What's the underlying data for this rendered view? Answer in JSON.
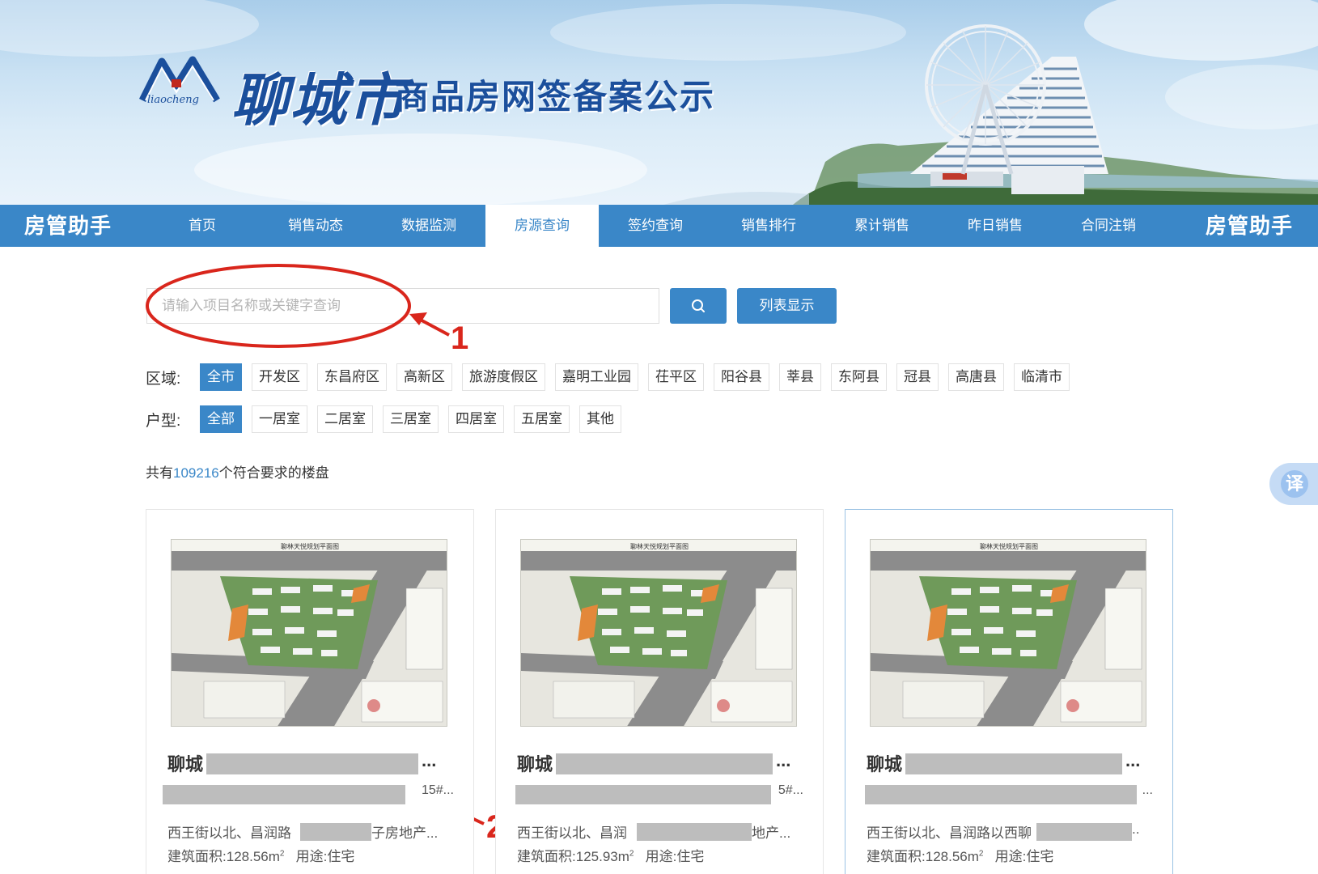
{
  "banner": {
    "logo_text": "聊城市",
    "subtitle": "商品房网签备案公示",
    "logo_pinyin": "liaocheng"
  },
  "nav": {
    "brand_left": "房管助手",
    "brand_right": "房管助手",
    "items": [
      {
        "label": "首页",
        "active": false
      },
      {
        "label": "销售动态",
        "active": false
      },
      {
        "label": "数据监测",
        "active": false
      },
      {
        "label": "房源查询",
        "active": true
      },
      {
        "label": "签约查询",
        "active": false
      },
      {
        "label": "销售排行",
        "active": false
      },
      {
        "label": "累计销售",
        "active": false
      },
      {
        "label": "昨日销售",
        "active": false
      },
      {
        "label": "合同注销",
        "active": false
      }
    ]
  },
  "search": {
    "placeholder": "请输入项目名称或关键字查询",
    "value": "",
    "search_icon": "search-icon",
    "list_button": "列表显示"
  },
  "annotations": {
    "one": "1",
    "two": "2"
  },
  "filters": {
    "region_label": "区域:",
    "regions": [
      "全市",
      "开发区",
      "东昌府区",
      "高新区",
      "旅游度假区",
      "嘉明工业园",
      "茌平区",
      "阳谷县",
      "莘县",
      "东阿县",
      "冠县",
      "高唐县",
      "临清市"
    ],
    "region_selected": "全市",
    "type_label": "户型:",
    "types": [
      "全部",
      "一居室",
      "二居室",
      "三居室",
      "四居室",
      "五居室",
      "其他"
    ],
    "type_selected": "全部"
  },
  "result": {
    "prefix": "共有",
    "count": "109216",
    "suffix": "个符合要求的楼盘"
  },
  "cards": [
    {
      "image_caption": "聊林天悦规划平面图",
      "title_prefix": "聊城",
      "title_suffix": "...",
      "sub_suffix": "15#...",
      "addr_prefix": "西王街以北、昌润路",
      "addr_suffix": "子房地产...",
      "area_label": "建筑面积:",
      "area": "128.56m",
      "use_label": "用途:",
      "use": "住宅"
    },
    {
      "image_caption": "聊林天悦规划平面图",
      "title_prefix": "聊城",
      "title_suffix": "...",
      "sub_suffix": "5#...",
      "addr_prefix": "西王街以北、昌润",
      "addr_suffix": "地产...",
      "area_label": "建筑面积:",
      "area": "125.93m",
      "use_label": "用途:",
      "use": "住宅"
    },
    {
      "image_caption": "聊林天悦规划平面图",
      "title_prefix": "聊城",
      "title_suffix": "...",
      "sub_suffix": "...",
      "addr_prefix": "西王街以北、昌润路以西聊",
      "addr_suffix": "..",
      "area_label": "建筑面积:",
      "area": "128.56m",
      "use_label": "用途:",
      "use": "住宅"
    }
  ],
  "translate_widget": "译",
  "colors": {
    "primary": "#3a87c8",
    "annotation_red": "#d9261c"
  }
}
